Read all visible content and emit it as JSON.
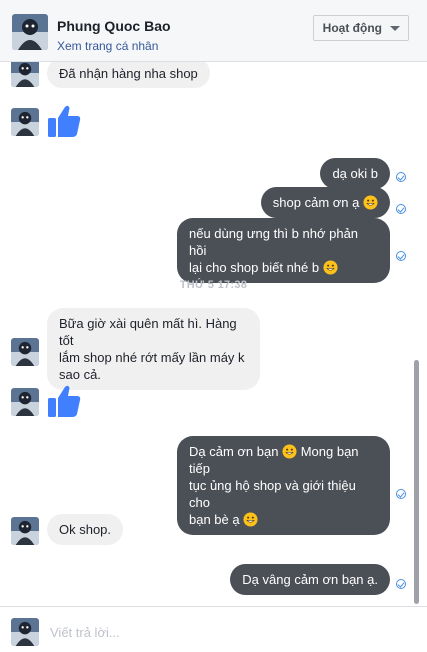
{
  "header": {
    "name": "Phung Quoc Bao",
    "profile_link": "Xem trang cá nhân",
    "status_button": "Hoạt động"
  },
  "messages": {
    "m1": "Đã nhận hàng nha shop",
    "m2": "dạ oki b",
    "m3": "shop cảm ơn ạ",
    "m4a": "nếu dùng ưng thì b nhớ phản hồi",
    "m4b": "lại cho shop biết nhé b",
    "timestamp": "THỨ 5 17:38",
    "m5a": "Bữa giờ xài quên mất hì. Hàng tốt",
    "m5b": "lắm shop nhé rớt mấy lần máy k",
    "m5c": "sao cả.",
    "m6a": "Dạ cảm ơn bạn",
    "m6b": "Mong bạn tiếp",
    "m6c": "tục ủng hộ shop và giới thiệu cho",
    "m6d": "bạn bè ạ",
    "m7": "Ok shop.",
    "m8": "Dạ vâng cảm ơn bạn ạ."
  },
  "composer": {
    "placeholder": "Viết trả lời..."
  },
  "icons": {
    "like": "thumbs-up-icon",
    "emoji": "grinning-face-icon",
    "seen": "seen-check-icon"
  },
  "colors": {
    "outgoing": "#4b4f56",
    "incoming": "#f1f0f0",
    "like": "#4080ff",
    "link": "#365899"
  }
}
